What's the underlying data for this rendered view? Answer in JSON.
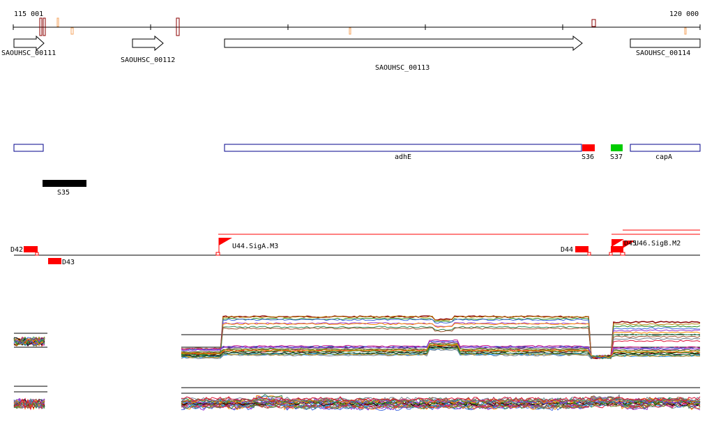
{
  "ruler": {
    "start_label": "115 001",
    "end_label": "120 000"
  },
  "genes": [
    {
      "label": "SAOUHSC_00111",
      "strand": "+"
    },
    {
      "label": "SAOUHSC_00112",
      "strand": "+"
    },
    {
      "label": "SAOUHSC_00113",
      "strand": "+"
    },
    {
      "label": "SAOUHSC_00114",
      "strand": "-"
    }
  ],
  "annotations": [
    {
      "label": "",
      "kind": "outline"
    },
    {
      "label": "adhE",
      "kind": "outline"
    },
    {
      "label": "S36",
      "kind": "red"
    },
    {
      "label": "S37",
      "kind": "green"
    },
    {
      "label": "capA",
      "kind": "outline"
    },
    {
      "label": "S35",
      "kind": "black"
    }
  ],
  "features": {
    "d42": "D42",
    "d43": "D43",
    "d44": "D44",
    "u44": "U44.SigA.M3",
    "d45": "D45",
    "u46": "U46.SigB.M2"
  },
  "colors": {
    "ruler": "#000000",
    "outline_box": "#00008b",
    "red_feature": "#ff0000",
    "green_feature": "#00cc00",
    "black_feature": "#000000",
    "dark_red_mark": "#8b0000",
    "pale_mark": "#f4a460"
  },
  "expression_tracks": [
    {
      "name": "track-1"
    },
    {
      "name": "track-2"
    }
  ]
}
